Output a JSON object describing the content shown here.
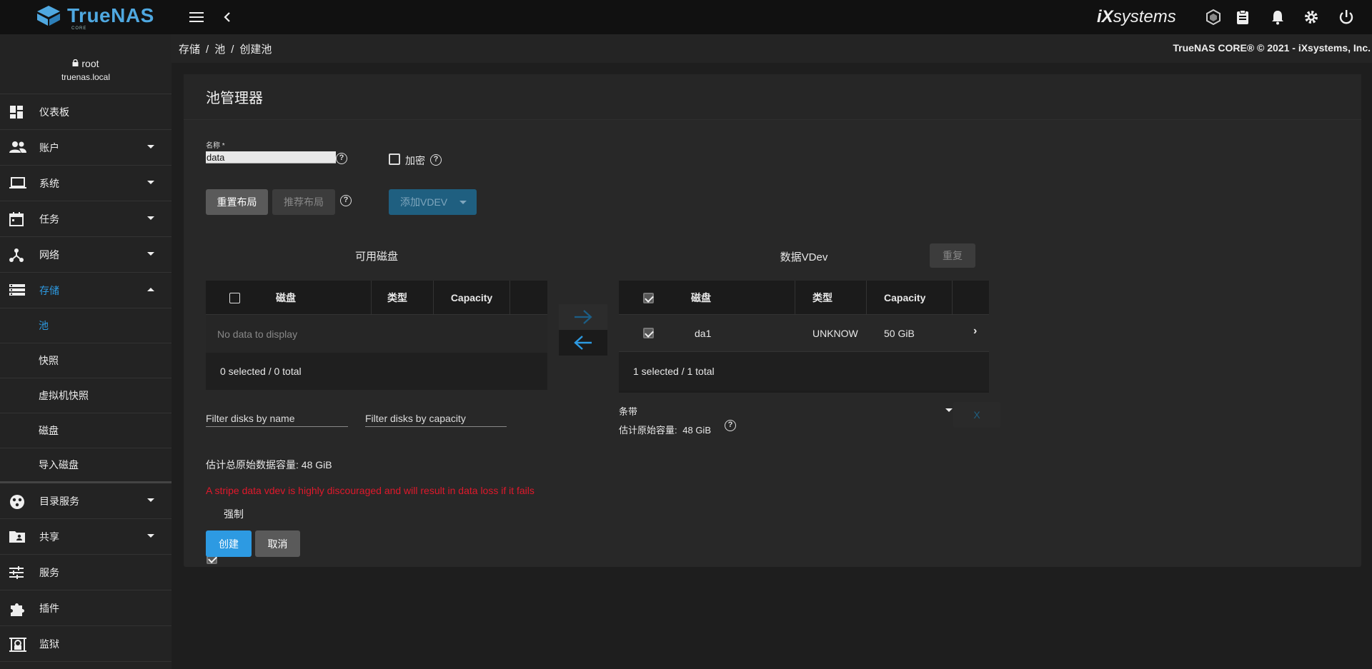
{
  "topbar": {
    "brand": "TrueNAS",
    "brand_sub": "CORE",
    "vendor_logo": "systems",
    "vendor_logo_prefix": "iX",
    "icons": [
      "menu-icon",
      "back-icon",
      "truecommand-icon",
      "clipboard-icon",
      "bell-icon",
      "gear-icon",
      "power-icon"
    ]
  },
  "sidebar": {
    "user": "root",
    "host": "truenas.local",
    "items": [
      {
        "label": "仪表板",
        "icon": "dashboard-icon"
      },
      {
        "label": "账户",
        "icon": "accounts-icon"
      },
      {
        "label": "系统",
        "icon": "laptop-icon"
      },
      {
        "label": "任务",
        "icon": "calendar-icon"
      },
      {
        "label": "网络",
        "icon": "network-icon"
      },
      {
        "label": "存储",
        "icon": "storage-icon"
      },
      {
        "label": "目录服务",
        "icon": "directory-icon"
      },
      {
        "label": "共享",
        "icon": "share-folder-icon"
      },
      {
        "label": "服务",
        "icon": "sliders-icon"
      },
      {
        "label": "插件",
        "icon": "puzzle-icon"
      },
      {
        "label": "监狱",
        "icon": "jail-icon"
      }
    ],
    "storage_sub": [
      "池",
      "快照",
      "虚拟机快照",
      "磁盘",
      "导入磁盘"
    ]
  },
  "breadcrumb": [
    "存储",
    "池",
    "创建池"
  ],
  "copyright": "TrueNAS CORE® © 2021 - iXsystems, Inc.",
  "card": {
    "title": "池管理器",
    "name_label": "名称 *",
    "name_value": "data",
    "encrypt_label": "加密",
    "reset_layout": "重置布局",
    "suggest_layout": "推荐布局",
    "add_vdev": "添加VDEV",
    "available_title": "可用磁盘",
    "data_vdev_title": "数据VDev",
    "repeat": "重复",
    "avail_cols": [
      "磁盘",
      "类型",
      "Capacity"
    ],
    "no_data": "No data to display",
    "avail_footer": "0 selected / 0 total",
    "vdev_cols": [
      "磁盘",
      "类型",
      "Capacity"
    ],
    "vdev_rows": [
      {
        "disk": "da1",
        "type": "UNKNOW",
        "capacity": "50 GiB"
      }
    ],
    "vdev_footer": "1 selected / 1 total",
    "filter_name": "Filter disks by name",
    "filter_capacity": "Filter disks by capacity",
    "layout_select": "条带",
    "est_raw_label": "估计原始容量:",
    "est_raw_value": "48 GiB",
    "remove_vdev": "X",
    "est_total": "估计总原始数据容量: 48 GiB",
    "warning": "A stripe data vdev is highly discouraged and will result in data loss if it fails",
    "force_label": "强制",
    "create": "创建",
    "cancel": "取消"
  },
  "colors": {
    "accent": "#2d9ae2",
    "warning": "#e0182b"
  }
}
